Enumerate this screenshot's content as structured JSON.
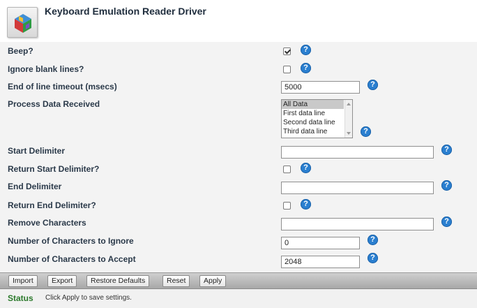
{
  "header": {
    "title": "Keyboard Emulation Reader Driver",
    "icon": "driver-app-icon"
  },
  "form": {
    "beep": {
      "label": "Beep?",
      "checked": true
    },
    "ignore_blank_lines": {
      "label": "Ignore blank lines?",
      "checked": false
    },
    "end_of_line_timeout": {
      "label": "End of line timeout (msecs)",
      "value": "5000"
    },
    "process_data_received": {
      "label": "Process Data Received",
      "options": [
        "All Data",
        "First data line",
        "Second data line",
        "Third data line"
      ],
      "selected": "All Data"
    },
    "start_delimiter": {
      "label": "Start Delimiter",
      "value": ""
    },
    "return_start_delimiter": {
      "label": "Return Start Delimiter?",
      "checked": false
    },
    "end_delimiter": {
      "label": "End Delimiter",
      "value": ""
    },
    "return_end_delimiter": {
      "label": "Return End Delimiter?",
      "checked": false
    },
    "remove_characters": {
      "label": "Remove Characters",
      "value": ""
    },
    "chars_to_ignore": {
      "label": "Number of Characters to Ignore",
      "value": "0"
    },
    "chars_to_accept": {
      "label": "Number of Characters to Accept",
      "value": "2048"
    },
    "help_glyph": "?"
  },
  "toolbar": {
    "import_label": "Import",
    "export_label": "Export",
    "restore_label": "Restore Defaults",
    "reset_label": "Reset",
    "apply_label": "Apply"
  },
  "status": {
    "label": "Status",
    "message": "Click Apply to save settings."
  },
  "colors": {
    "help_blue": "#2a7fd0",
    "status_green": "#2c7a2c",
    "form_bg": "#f3f3f3"
  }
}
